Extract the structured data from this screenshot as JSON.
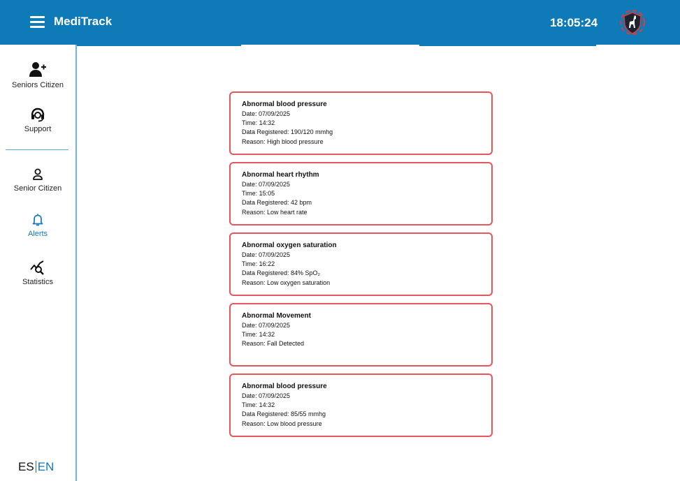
{
  "header": {
    "app_title": "MediTrack",
    "time": "18:05:24"
  },
  "sidebar": {
    "items": [
      {
        "label": "Seniors Citizen",
        "icon": "add-user-icon"
      },
      {
        "label": "Support",
        "icon": "headset-icon"
      },
      {
        "label": "Senior Citizen",
        "icon": "user-icon"
      },
      {
        "label": "Alerts",
        "icon": "bell-icon",
        "active": true
      },
      {
        "label": "Statistics",
        "icon": "chart-search-icon"
      }
    ]
  },
  "language": {
    "es": "ES",
    "en": "EN",
    "selected": "EN"
  },
  "alerts": [
    {
      "title": "Abnormal blood pressure",
      "date": "Date: 07/09/2025",
      "time": "Time: 14:32",
      "data": "Data Registered: 190/120 mmhg",
      "reason": "Reason: High blood pressure"
    },
    {
      "title": "Abnormal heart rhythm",
      "date": "Date: 07/09/2025",
      "time": "Time: 15:05",
      "data": "Data Registered: 42 bpm",
      "reason": "Reason: Low heart rate"
    },
    {
      "title": "Abnormal oxygen saturation",
      "date": "Date: 07/09/2025",
      "time": "Time: 16:22",
      "data": "Data Registered: 84% SpO₂",
      "reason": "Reason: Low oxygen saturation"
    },
    {
      "title": "Abnormal Movement",
      "date": "Date: 07/09/2025",
      "time": "Time: 14:32",
      "reason": "Reason: Fall Detected"
    },
    {
      "title": "Abnormal blood pressure",
      "date": "Date: 07/09/2025",
      "time": "Time: 14:32",
      "data": "Data Registered: 85/55 mmhg",
      "reason": "Reason: Low blood pressure"
    }
  ],
  "colors": {
    "header": "#0f7ab8",
    "alert_border": "#e8555b",
    "active": "#1479bd"
  }
}
